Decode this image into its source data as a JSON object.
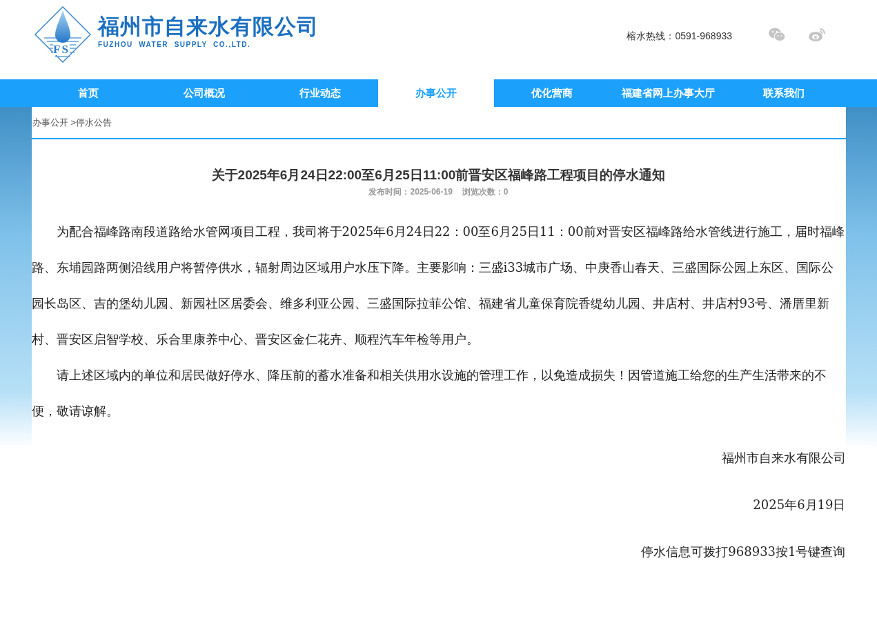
{
  "header": {
    "company_name": "福州市自来水有限公司",
    "company_name_en": "FUZHOU  WATER  SUPPLY  CO.,LTD.",
    "logo_letters": "FS",
    "hotline": "榕水热线：0591-968933"
  },
  "nav": [
    {
      "label": "首页",
      "selected": false
    },
    {
      "label": "公司概况",
      "selected": false
    },
    {
      "label": "行业动态",
      "selected": false
    },
    {
      "label": "办事公开",
      "selected": true
    },
    {
      "label": "优化营商",
      "selected": false
    },
    {
      "label": "福建省网上办事大厅",
      "selected": false
    },
    {
      "label": "联系我们",
      "selected": false
    }
  ],
  "breadcrumb": [
    "办事公开",
    ">停水公告"
  ],
  "article": {
    "title": "关于2025年6月24日22:00至6月25日11:00前晋安区福峰路工程项目的停水通知",
    "publish_time": "发布时间：2025-06-19",
    "views": "浏览次数：0",
    "paragraphs": [
      "为配合福峰路南段道路给水管网项目工程，我司将于2025年6月24日22：00至6月25日11：00前对晋安区福峰路给水管线进行施工，届时福峰路、东埔园路两侧沿线用户将暂停供水，辐射周边区域用户水压下降。主要影响：三盛i33城市广场、中庚香山春天、三盛国际公园上东区、国际公园长岛区、吉的堡幼儿园、新园社区居委会、维多利亚公园、三盛国际拉菲公馆、福建省儿童保育院香缇幼儿园、井店村、井店村93号、潘厝里新村、晋安区启智学校、乐合里康养中心、晋安区金仁花卉、顺程汽车年检等用户。",
      "请上述区域内的单位和居民做好停水、降压前的蓄水准备和相关供用水设施的管理工作，以免造成损失！因管道施工给您的生产生活带来的不便，敬请谅解。"
    ],
    "signature": [
      "福州市自来水有限公司",
      "2025年6月19日",
      "停水信息可拨打968933按1号键查询"
    ]
  }
}
